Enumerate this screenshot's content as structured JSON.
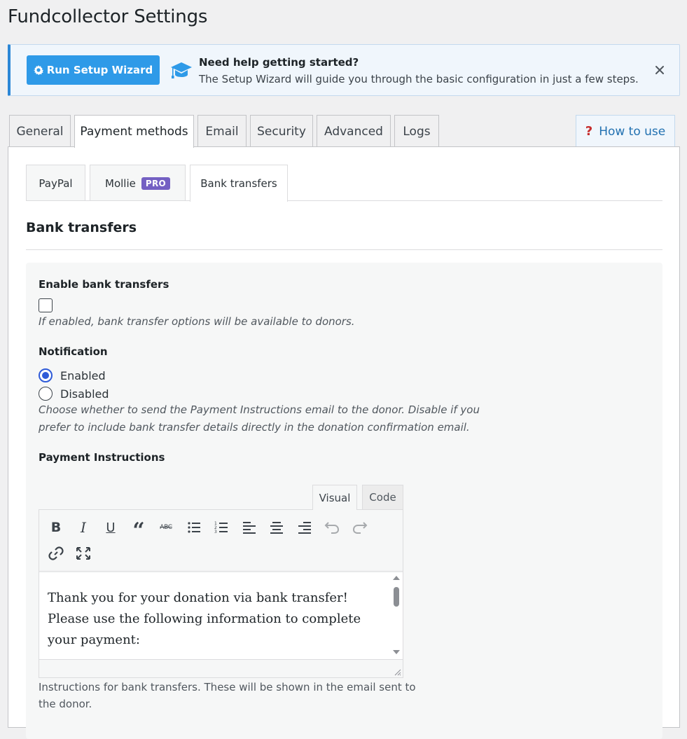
{
  "page": {
    "title": "Fundcollector Settings"
  },
  "notice": {
    "button_label": "Run Setup Wizard",
    "heading": "Need help getting started?",
    "text": "The Setup Wizard will guide you through the basic configuration in just a few steps."
  },
  "tabs": [
    {
      "label": "General",
      "active": false
    },
    {
      "label": "Payment methods",
      "active": true
    },
    {
      "label": "Email",
      "active": false
    },
    {
      "label": "Security",
      "active": false
    },
    {
      "label": "Advanced",
      "active": false
    },
    {
      "label": "Logs",
      "active": false
    }
  ],
  "help_link": {
    "label": "How to use",
    "icon": "question-icon"
  },
  "subtabs": [
    {
      "label": "PayPal",
      "active": false
    },
    {
      "label": "Mollie",
      "badge": "PRO",
      "active": false
    },
    {
      "label": "Bank transfers",
      "active": true
    }
  ],
  "section": {
    "title": "Bank transfers",
    "enable": {
      "label": "Enable bank transfers",
      "checked": false,
      "description": "If enabled, bank transfer options will be available to donors."
    },
    "notification": {
      "label": "Notification",
      "options": [
        {
          "label": "Enabled",
          "checked": true
        },
        {
          "label": "Disabled",
          "checked": false
        }
      ],
      "description_line1": "Choose whether to send the Payment Instructions email to the donor. Disable if you",
      "description_line2": "prefer to include bank transfer details directly in the donation confirmation email."
    },
    "instructions": {
      "label": "Payment Instructions",
      "editor_tabs": [
        {
          "label": "Visual",
          "active": true
        },
        {
          "label": "Code",
          "active": false
        }
      ],
      "content": "Thank you for your donation via bank transfer! Please use the following information to complete your payment:",
      "description_line1": "Instructions for bank transfers. These will be shown in the email sent to",
      "description_line2": "the donor."
    }
  },
  "colors": {
    "primary_button": "#2e9ae8",
    "notice_border": "#2c87d6",
    "radio_checked": "#2f5bd8",
    "pro_badge": "#7460c3",
    "help_question": "#c62d2d",
    "link": "#2271b1"
  }
}
